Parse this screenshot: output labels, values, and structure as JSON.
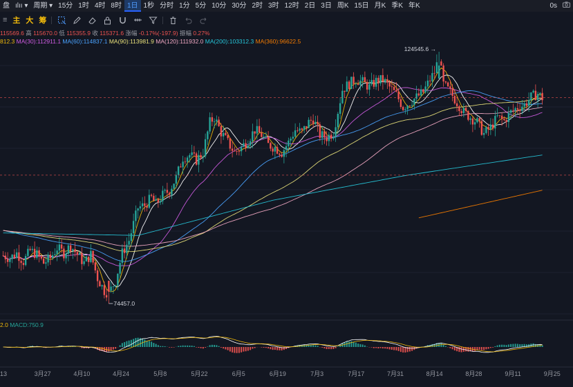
{
  "toolbar": {
    "left_label": "盘",
    "chart_type_glyph": "ılıı",
    "period_label": "周期",
    "intervals": [
      "15分",
      "1时",
      "4时",
      "8时",
      "1日",
      "1秒",
      "分时",
      "1分",
      "5分",
      "10分",
      "30分",
      "2时",
      "3时",
      "12时",
      "2日",
      "3日",
      "周K",
      "15日",
      "月K",
      "季K",
      "年K"
    ],
    "active_interval": "1日",
    "right_value": "0s"
  },
  "indicator_buttons": [
    "主",
    "大",
    "筹"
  ],
  "ohlc": {
    "open_text": "115569.6",
    "high_label": "高",
    "high_text": "115670.0",
    "low_label": "低",
    "low_text": "115355.9",
    "close_label": "收",
    "close_text": "115371.6",
    "change_label": "涨幅",
    "change_text": "-0.17%(-197.9)",
    "amp_label": "振幅",
    "amp_text": "0.27%"
  },
  "ma_legend": [
    {
      "text": "812.3",
      "color": "#f0b90b"
    },
    {
      "text": "MA(30):112911.1",
      "color": "#d05ce3"
    },
    {
      "text": "MA(60):114837.1",
      "color": "#4aa3ff"
    },
    {
      "text": "MA(90):113981.9",
      "color": "#e8e07a"
    },
    {
      "text": "MA(120):111932.0",
      "color": "#f2a9c4"
    },
    {
      "text": "MA(200):103312.3",
      "color": "#26c6da"
    },
    {
      "text": "MA(360):96622.5",
      "color": "#f57c00"
    }
  ],
  "macd_legend": {
    "prefix": "2.0",
    "label": "MACD:750.9"
  },
  "annotations": {
    "high": "124545.6",
    "low": "74457.0"
  },
  "colors": {
    "up": "#26a69a",
    "down": "#ef5350",
    "bg": "#131722",
    "grid": "#1f2430"
  },
  "chart_data": {
    "type": "candlestick",
    "x_tick_labels": [
      "13",
      "3月27",
      "4月10",
      "4月24",
      "5月8",
      "5月22",
      "6月5",
      "6月19",
      "7月3",
      "7月17",
      "7月31",
      "8月14",
      "8月28",
      "9月11",
      "9月25"
    ],
    "ylim": [
      70000,
      130000
    ],
    "dashed_levels": [
      115400,
      100000
    ],
    "highlight_price": {
      "value": 124545.6,
      "label": "124545.6"
    },
    "lowlight_price": {
      "value": 74457.0,
      "label": "74457.0"
    },
    "price_path": [
      [
        0,
        84000
      ],
      [
        3,
        83500
      ],
      [
        6,
        84500
      ],
      [
        9,
        82800
      ],
      [
        12,
        85000
      ],
      [
        15,
        84200
      ],
      [
        18,
        82500
      ],
      [
        21,
        83500
      ],
      [
        24,
        85500
      ],
      [
        27,
        84500
      ],
      [
        30,
        86000
      ],
      [
        33,
        84200
      ],
      [
        36,
        82500
      ],
      [
        39,
        84200
      ],
      [
        42,
        79500
      ],
      [
        45,
        77000
      ],
      [
        47,
        76500
      ],
      [
        50,
        79000
      ],
      [
        53,
        84500
      ],
      [
        56,
        87000
      ],
      [
        60,
        93500
      ],
      [
        63,
        94000
      ],
      [
        66,
        95500
      ],
      [
        68,
        94200
      ],
      [
        71,
        96000
      ],
      [
        74,
        97000
      ],
      [
        77,
        99500
      ],
      [
        80,
        103500
      ],
      [
        83,
        104000
      ],
      [
        86,
        103000
      ],
      [
        89,
        104500
      ],
      [
        92,
        110500
      ],
      [
        94,
        111500
      ],
      [
        97,
        108500
      ],
      [
        100,
        106500
      ],
      [
        103,
        104500
      ],
      [
        106,
        105500
      ],
      [
        109,
        107000
      ],
      [
        112,
        109000
      ],
      [
        115,
        108000
      ],
      [
        118,
        106000
      ],
      [
        121,
        105500
      ],
      [
        124,
        104500
      ],
      [
        127,
        106500
      ],
      [
        130,
        109000
      ],
      [
        133,
        108500
      ],
      [
        136,
        110500
      ],
      [
        138,
        111200
      ],
      [
        141,
        108000
      ],
      [
        144,
        107500
      ],
      [
        147,
        108500
      ],
      [
        151,
        117000
      ],
      [
        154,
        118200
      ],
      [
        157,
        119000
      ],
      [
        160,
        118500
      ],
      [
        163,
        117500
      ],
      [
        166,
        118700
      ],
      [
        169,
        119000
      ],
      [
        172,
        117500
      ],
      [
        175,
        116000
      ],
      [
        178,
        113500
      ],
      [
        181,
        114500
      ],
      [
        184,
        115500
      ],
      [
        187,
        116500
      ],
      [
        190,
        119000
      ],
      [
        192,
        120500
      ],
      [
        194,
        123500
      ],
      [
        196,
        118000
      ],
      [
        199,
        116500
      ],
      [
        202,
        114500
      ],
      [
        205,
        112500
      ],
      [
        208,
        111500
      ],
      [
        211,
        110500
      ],
      [
        214,
        108200
      ],
      [
        217,
        109500
      ],
      [
        220,
        111500
      ],
      [
        223,
        110800
      ],
      [
        226,
        112500
      ],
      [
        229,
        113500
      ],
      [
        232,
        114000
      ],
      [
        235,
        115500
      ],
      [
        238,
        116200
      ],
      [
        240,
        115371
      ]
    ],
    "ma_series": [
      {
        "period": "short",
        "color": "#f0b90b",
        "lag": 5
      },
      {
        "period": "mid",
        "color": "#ffffff",
        "lag": 10
      },
      {
        "period": "30",
        "color": "#d05ce3",
        "lag": 30
      },
      {
        "period": "60",
        "color": "#4aa3ff",
        "lag": 60
      },
      {
        "period": "90",
        "color": "#e8e07a",
        "lag": 90
      },
      {
        "period": "120",
        "color": "#f2a9c4",
        "lag": 120
      },
      {
        "period": "200",
        "color": "#26c6da",
        "lag": 200
      },
      {
        "period": "360",
        "color": "#f57c00",
        "lag": 360
      }
    ],
    "ma_anchors": {
      "200": [
        [
          0,
          88500
        ],
        [
          60,
          88000
        ],
        [
          120,
          95000
        ],
        [
          180,
          100000
        ],
        [
          240,
          104000
        ]
      ],
      "360": [
        [
          185,
          91500
        ],
        [
          240,
          97000
        ]
      ]
    }
  }
}
